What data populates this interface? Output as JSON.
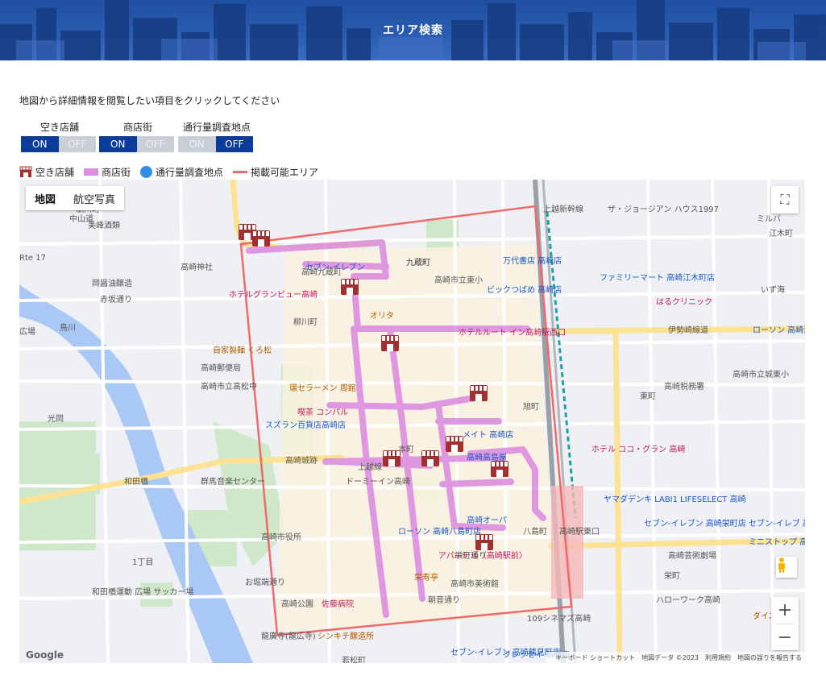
{
  "header": {
    "title": "エリア検索"
  },
  "instruction": "地図から詳細情報を閲覧したい項目をクリックしてください",
  "toggles": [
    {
      "label": "空き店舗",
      "on": "ON",
      "off": "OFF",
      "state": "ON"
    },
    {
      "label": "商店街",
      "on": "ON",
      "off": "OFF",
      "state": "ON"
    },
    {
      "label": "通行量調査地点",
      "on": "ON",
      "off": "OFF",
      "state": "OFF"
    }
  ],
  "legend": {
    "vacant_shop": "空き店舗",
    "shopping_street": "商店街",
    "traffic_point": "通行量調査地点",
    "area": "掲載可能エリア"
  },
  "map": {
    "type_buttons": {
      "map": "地図",
      "satellite": "航空写真"
    },
    "zoom_in": "+",
    "zoom_out": "−",
    "google": "Google",
    "attribution": {
      "shortcuts": "キーボード ショートカット",
      "data": "地図データ ©2023",
      "terms": "利用規約",
      "report": "地図の誤りを報告する"
    },
    "colors": {
      "area_outline": "#ef6a6a",
      "street": "#dd8fe0",
      "shop_icon": "#a33030"
    },
    "labels": [
      "歌川町",
      "美峰酒類",
      "高崎神社",
      "岡醤油醸造",
      "赤坂通り",
      "鳥川",
      "広場",
      "Rte 17",
      "高崎九蔵町",
      "九蔵町",
      "高崎市立東小",
      "万代書店 高崎店",
      "ザ・ジョージアン ハウス1997",
      "ミルバ",
      "江木町",
      "セブン-イレブン",
      "ホテルグランビュー高崎",
      "柳川町",
      "オリタ",
      "ホテルルート イン高崎駅西口",
      "ビックつばめ 高崎店",
      "ファミリーマート 高崎江木町店",
      "はるクリニック",
      "いず海",
      "伊勢崎線道",
      "ローソン 高崎江木",
      "自家製麺 くろ松",
      "高崎郵便局",
      "高崎市立高松中",
      "環セラーメン 周館",
      "喫茶 コンパル",
      "スズラン百貨店高崎店",
      "高崎市立城東小",
      "高崎税務署",
      "東町",
      "旭町",
      "メイト 高崎店",
      "ホテル ココ・グラン 高崎",
      "高崎高島屋",
      "高崎城跡",
      "群馬音楽センター",
      "ドーミーイン高崎",
      "和田橋",
      "高崎オーパ",
      "ヤマダデンキ LABI1 LIFESELECT 高崎",
      "セブン-イレブン 高崎栄町店",
      "セブン-イレブ 高崎岩押町店",
      "八島町",
      "高崎市役所",
      "ローソン 高崎八島町店",
      "ミニストップ 高崎岩押町店",
      "1丁目",
      "アパホテル〈高崎駅前〉",
      "高崎芸術劇場",
      "和田橋運動 広場 サッカー場",
      "栄寿亭",
      "高崎市美術館",
      "栄町",
      "ハローワーク高崎",
      "お堀端通り",
      "高崎公園",
      "佐藤病院",
      "朝音通り",
      "109シネマズ高崎",
      "ダイニング",
      "龍廣寺(龍広寺)",
      "シンキチ醸造所",
      "フレッセイ 石原店",
      "セブン-イレブン 高崎鶴見町店",
      "若松町",
      "九蔵町",
      "光岡",
      "上越新幹線",
      "中山道",
      "本町",
      "高崎駅",
      "栄町通り",
      "東口",
      "上越線"
    ]
  }
}
